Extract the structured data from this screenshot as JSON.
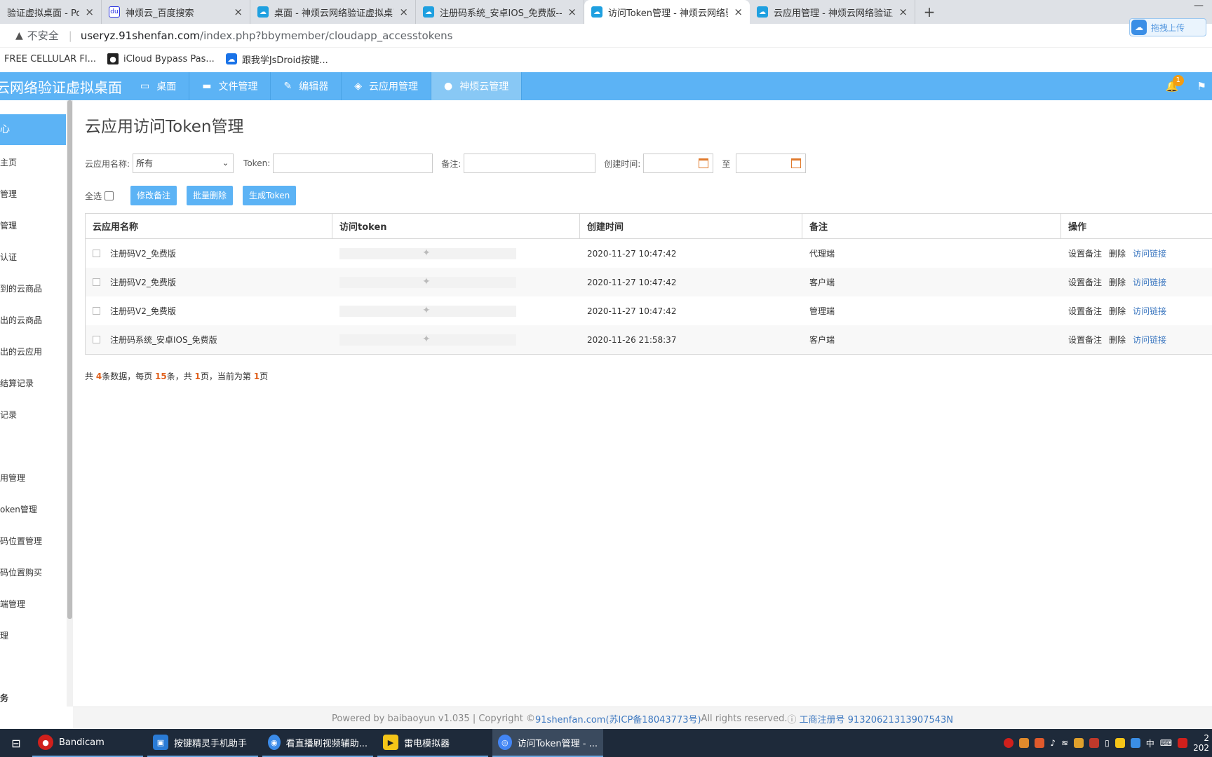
{
  "browser": {
    "tabs": [
      {
        "title": "验证虚拟桌面 - Power",
        "icon": "cloud",
        "active": false
      },
      {
        "title": "神烦云_百度搜索",
        "icon": "baidu",
        "active": false
      },
      {
        "title": "桌面 - 神烦云网络验证虚拟桌面",
        "icon": "cloud",
        "active": false
      },
      {
        "title": "注册码系统_安卓IOS_免费版--神",
        "icon": "cloud",
        "active": false
      },
      {
        "title": "访问Token管理 - 神烦云网络验",
        "icon": "cloud",
        "active": true
      },
      {
        "title": "云应用管理 - 神烦云网络验证虚",
        "icon": "cloud",
        "active": false
      }
    ],
    "new_tab": "+",
    "minimize": "—",
    "address": {
      "insecure_label": "不安全",
      "host": "useryz.91shenfan.com",
      "path": "/index.php?bbymember/cloudapp_accesstokens"
    },
    "upload_label": "拖拽上传",
    "bookmarks": [
      {
        "label": "FREE CELLULAR FI...",
        "icon": ""
      },
      {
        "label": "iCloud Bypass Pas...",
        "icon": "apple-icon"
      },
      {
        "label": "跟我学JsDroid按键...",
        "icon": "cloud-icon"
      }
    ]
  },
  "app": {
    "brand": "云网络验证虚拟桌面",
    "nav": [
      {
        "label": "桌面",
        "icon": "monitor-icon",
        "active": false
      },
      {
        "label": "文件管理",
        "icon": "folder-icon",
        "active": false
      },
      {
        "label": "编辑器",
        "icon": "edit-icon",
        "active": false
      },
      {
        "label": "云应用管理",
        "icon": "cube-icon",
        "active": false
      },
      {
        "label": "神烦云管理",
        "icon": "user-icon",
        "active": true
      }
    ],
    "notification_count": "1"
  },
  "sidebar": {
    "active": "心",
    "items": [
      "主页",
      "管理",
      "管理",
      "认证",
      "到的云商品",
      "出的云商品",
      "出的云应用",
      "结算记录",
      "记录",
      "用管理",
      "oken管理",
      "码位置管理",
      "码位置购买",
      "端管理",
      "理",
      "务"
    ]
  },
  "page": {
    "title": "云应用访问Token管理",
    "filters": {
      "app_label": "云应用名称:",
      "app_value": "所有",
      "token_label": "Token:",
      "token_value": "",
      "remark_label": "备注:",
      "remark_value": "",
      "created_label": "创建时间:",
      "to_label": "至",
      "date_from": "",
      "date_to": ""
    },
    "select_all": "全选",
    "buttons": {
      "edit_remark": "修改备注",
      "batch_delete": "批量删除",
      "generate": "生成Token"
    },
    "table": {
      "headers": [
        "云应用名称",
        "访问token",
        "创建时间",
        "备注",
        "操作"
      ],
      "rows": [
        {
          "name": "注册码V2_免费版",
          "time": "2020-11-27 10:47:42",
          "remark": "代理端"
        },
        {
          "name": "注册码V2_免费版",
          "time": "2020-11-27 10:47:42",
          "remark": "客户端"
        },
        {
          "name": "注册码V2_免费版",
          "time": "2020-11-27 10:47:42",
          "remark": "管理端"
        },
        {
          "name": "注册码系统_安卓IOS_免费版",
          "time": "2020-11-26 21:58:37",
          "remark": "客户端"
        }
      ],
      "ops": [
        "设置备注",
        "删除",
        "访问链接"
      ]
    },
    "pager": {
      "p1": "共 ",
      "total": "4",
      "p2": "条数据，每页 ",
      "per_page": "15",
      "p3": "条，共 ",
      "pages": "1",
      "p4": "页，当前为第 ",
      "current": "1",
      "p5": "页"
    }
  },
  "footer": {
    "powered": "Powered by baibaoyun v1.035 | Copyright © ",
    "site": "91shenfan.com(苏ICP备18043773号)",
    "rights": " All rights reserved. ",
    "reg": "工商注册号 91320621313907543N"
  },
  "taskbar": {
    "apps": [
      {
        "label": "Bandicam",
        "color": "#d0201c"
      },
      {
        "label": "按键精灵手机助手",
        "color": "#2a7bd5"
      },
      {
        "label": "看直播刷视频辅助...",
        "color": "#3b8be8"
      },
      {
        "label": "雷电模拟器",
        "color": "#f5c518"
      },
      {
        "label": "访问Token管理 - ...",
        "color": "#4285f4"
      }
    ],
    "ime": "中",
    "clock_top": "2",
    "clock_bottom": "202"
  },
  "colors": {
    "nav_blue": "#5cb3f5",
    "link_blue": "#3d78c0",
    "accent_orange": "#e0601c"
  }
}
